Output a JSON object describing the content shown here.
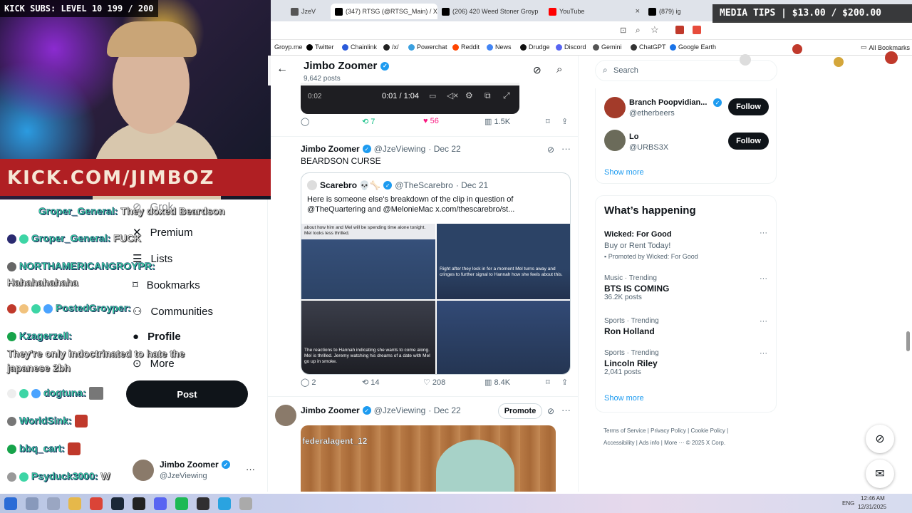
{
  "overlay": {
    "kick_subs": "KICK SUBS: LEVEL 10 199 / 200",
    "media_tips": "MEDIA TIPS | $13.00 / $200.00",
    "banner_text": "KICK.COM/JIMBOZ"
  },
  "browser": {
    "tabs": [
      {
        "label": "JzeV",
        "icon_color": "#555555"
      },
      {
        "label": "(347) RTSG (@RTSG_Main) / X",
        "icon_color": "#000000"
      },
      {
        "label": "(206) 420 Weed Stoner Groyp",
        "icon_color": "#000000"
      },
      {
        "label": "YouTube",
        "icon_color": "#ff0000"
      },
      {
        "label": "(879) ig",
        "icon_color": "#000000"
      }
    ],
    "bookmarks": [
      {
        "label": "Groyp.me",
        "icon": "globe-icon",
        "color": "#888888"
      },
      {
        "label": "Twitter",
        "icon": "x-logo-icon",
        "color": "#000000"
      },
      {
        "label": "Chainlink",
        "icon": "chainlink-icon",
        "color": "#2a5ada"
      },
      {
        "label": "/x/",
        "icon": "clover-icon",
        "color": "#222222"
      },
      {
        "label": "Powerchat",
        "icon": "powerchat-icon",
        "color": "#3aa0e0"
      },
      {
        "label": "Reddit",
        "icon": "reddit-icon",
        "color": "#ff4500"
      },
      {
        "label": "News",
        "icon": "news-icon",
        "color": "#4285f4"
      },
      {
        "label": "Drudge",
        "icon": "drudge-icon",
        "color": "#111111"
      },
      {
        "label": "Discord",
        "icon": "discord-icon",
        "color": "#5865f2"
      },
      {
        "label": "Gemini",
        "icon": "gemini-icon",
        "color": "#555555"
      },
      {
        "label": "ChatGPT",
        "icon": "chatgpt-icon",
        "color": "#333333"
      },
      {
        "label": "Google Earth",
        "icon": "earth-icon",
        "color": "#1a73e8"
      }
    ],
    "all_bookmarks": "All Bookmarks"
  },
  "chat": [
    {
      "user": "Groper_General:",
      "msg": "They doxed Beardson",
      "badge_color": ""
    },
    {
      "user": "Groper_General:",
      "msg": "FUCK",
      "badge_color": "#3dd5a5"
    },
    {
      "user": "NORTHAMERICANGROYPR:",
      "msg": "Hahahahahaha",
      "badge_color": "#666666"
    },
    {
      "user": "PostedGroyper:",
      "msg": "",
      "badge_color": "#c0392b"
    },
    {
      "user": "Kzagerzell:",
      "msg": "They're only indoctrinated to hate the japanese 2bh",
      "badge_color": "#16a34a"
    },
    {
      "user": "dogtuna:",
      "msg": "",
      "badge_color": "#eeeeee"
    },
    {
      "user": "WorldSink:",
      "msg": "",
      "badge_color": "#777777"
    },
    {
      "user": "bbq_cart:",
      "msg": "",
      "badge_color": "#16a34a"
    },
    {
      "user": "Psyduck3000:",
      "msg": "W",
      "badge_color": "#999999"
    }
  ],
  "nav": {
    "items": [
      {
        "label": "Grok",
        "icon": "grok-icon"
      },
      {
        "label": "Premium",
        "icon": "x-logo-icon"
      },
      {
        "label": "Lists",
        "icon": "lists-icon"
      },
      {
        "label": "Bookmarks",
        "icon": "bookmark-icon"
      },
      {
        "label": "Communities",
        "icon": "communities-icon"
      },
      {
        "label": "Profile",
        "icon": "profile-icon"
      },
      {
        "label": "More",
        "icon": "more-circle-icon"
      }
    ],
    "post_button": "Post",
    "account_name": "Jimbo Zoomer",
    "account_handle": "@JzeViewing"
  },
  "profile_header": {
    "name": "Jimbo Zoomer",
    "posts": "9,642 posts"
  },
  "video": {
    "time": "0:01 / 1:04",
    "small_time": "0:02"
  },
  "tweet0_actions": {
    "retweets": "7",
    "likes": "56",
    "views": "1.5K"
  },
  "tweet1": {
    "name": "Jimbo Zoomer",
    "handle": "@JzeViewing",
    "date": "· Dec 22",
    "text": "BEARDSON CURSE",
    "quote": {
      "name": "Scarebro 💀🦴",
      "handle": "@TheScarebro",
      "date": "· Dec 21",
      "text": "Here is someone else's breakdown of the clip in question of @TheQuartering and @MelonieMac x.com/thescarebro/st...",
      "captions": [
        "about how him and Mel will be spending time alone tonight. Mel looks less thrilled.",
        "Right after they lock in for a moment Mel turns away and cringes to further signal to Hannah how she feels about this.",
        "The reactions to Hannah indicating she wants to come along. Mel is thrilled. Jeremy watching his dreams of a date with Mel go up in smoke.",
        ""
      ]
    },
    "actions": {
      "replies": "2",
      "retweets": "14",
      "likes": "208",
      "views": "8.4K"
    }
  },
  "tweet2": {
    "name": "Jimbo Zoomer",
    "handle": "@JzeViewing",
    "date": "· Dec 22",
    "promote": "Promote",
    "media_label": "federalagent_12"
  },
  "right": {
    "search_placeholder": "Search",
    "follow_suggestions": [
      {
        "name": "Branch Poopvidian...",
        "handle": "@etherbeers",
        "button": "Follow",
        "avatar_color": "#a33b2a"
      },
      {
        "name": "Lo",
        "handle": "@URBS3X",
        "button": "Follow",
        "avatar_color": "#6b6b5a"
      }
    ],
    "show_more": "Show more",
    "whats_happening_title": "What’s happening",
    "promo": {
      "title": "Wicked: For Good",
      "sub": "Buy or Rent Today!",
      "promoted": "Promoted by Wicked: For Good"
    },
    "trends": [
      {
        "context": "Music · Trending",
        "title": "BTS IS COMING",
        "posts": "36.2K posts"
      },
      {
        "context": "Sports · Trending",
        "title": "Ron Holland",
        "posts": ""
      },
      {
        "context": "Sports · Trending",
        "title": "Lincoln Riley",
        "posts": "2,041 posts"
      }
    ],
    "show_more_2": "Show more",
    "footer": [
      "Terms of Service",
      "Privacy Policy",
      "Cookie Policy",
      "Accessibility",
      "Ads info",
      "More ···",
      "© 2025 X Corp."
    ]
  },
  "taskbar": {
    "lang": "ENG",
    "time": "12:46 AM",
    "date": "12/31/2025"
  }
}
